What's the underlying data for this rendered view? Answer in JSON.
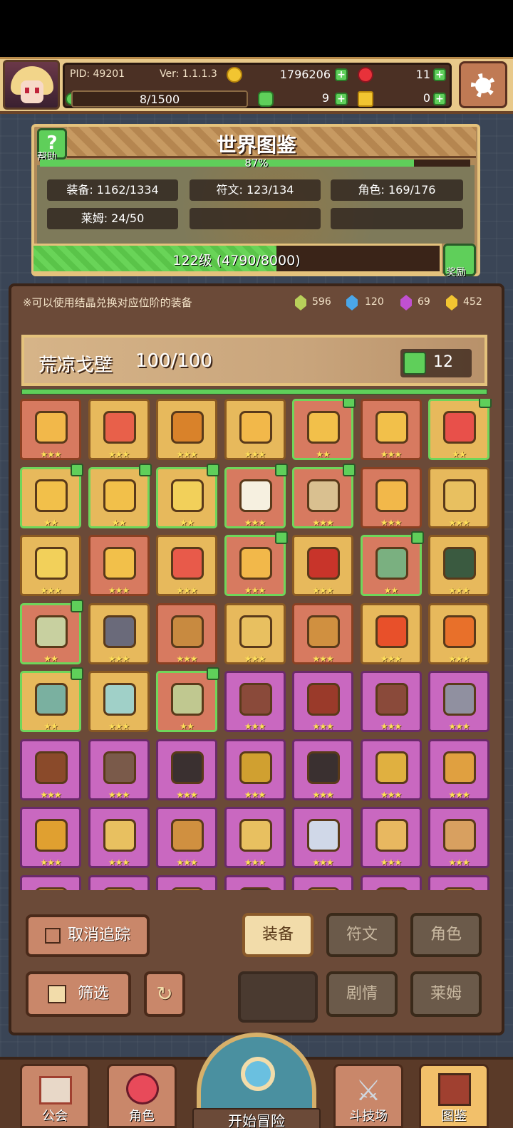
{
  "topbar": {
    "pid": "PID: 49201",
    "version": "Ver: 1.1.1.3",
    "gold": "1796206",
    "red_gems": "11",
    "xp": "8/1500",
    "clover": "9",
    "keys": "0"
  },
  "encyclopedia": {
    "title": "世界图鉴",
    "help_label": "帮助",
    "percent": "87%",
    "percent_value": 87,
    "stats": [
      {
        "label": "装备: 1162/1334"
      },
      {
        "label": "符文: 123/134"
      },
      {
        "label": "角色: 169/176"
      },
      {
        "label": "莱姆: 24/50"
      }
    ],
    "level_text": "122级 (4790/8000)",
    "level_fraction": 0.599,
    "reward_label": "奖励"
  },
  "notice": "※可以使用结晶兑换对应位阶的装备",
  "crystals": [
    {
      "color": "#b8d05a",
      "value": "596"
    },
    {
      "color": "#4aa6e8",
      "value": "120"
    },
    {
      "color": "#c050d0",
      "value": "69"
    },
    {
      "color": "#f2c531",
      "value": "452"
    }
  ],
  "region": {
    "name": "荒凉戈壁",
    "count": "100/100",
    "likes": "12"
  },
  "items": [
    {
      "kind": "red",
      "stars": 3,
      "tracked": false,
      "color": "#f2b84a"
    },
    {
      "kind": "gold",
      "stars": 3,
      "tracked": false,
      "color": "#e8604a"
    },
    {
      "kind": "gold",
      "stars": 3,
      "tracked": false,
      "color": "#d9822a"
    },
    {
      "kind": "gold",
      "stars": 3,
      "tracked": false,
      "color": "#f2b84a"
    },
    {
      "kind": "red",
      "stars": 2,
      "tracked": true,
      "color": "#f2c04a"
    },
    {
      "kind": "red",
      "stars": 3,
      "tracked": false,
      "color": "#f2c04a"
    },
    {
      "kind": "gold",
      "stars": 2,
      "tracked": true,
      "color": "#e8504a"
    },
    {
      "kind": "gold",
      "stars": 2,
      "tracked": true,
      "color": "#f2c04a"
    },
    {
      "kind": "gold",
      "stars": 2,
      "tracked": true,
      "color": "#f2c04a"
    },
    {
      "kind": "gold",
      "stars": 2,
      "tracked": true,
      "color": "#f2d05a"
    },
    {
      "kind": "red",
      "stars": 3,
      "tracked": true,
      "color": "#f6f0e0"
    },
    {
      "kind": "red",
      "stars": 3,
      "tracked": true,
      "color": "#d9c090"
    },
    {
      "kind": "red",
      "stars": 3,
      "tracked": false,
      "color": "#f2b84a"
    },
    {
      "kind": "gold",
      "stars": 3,
      "tracked": false,
      "color": "#e8c060"
    },
    {
      "kind": "gold",
      "stars": 3,
      "tracked": false,
      "color": "#f2d05a"
    },
    {
      "kind": "red",
      "stars": 3,
      "tracked": false,
      "color": "#f2c04a"
    },
    {
      "kind": "gold",
      "stars": 3,
      "tracked": false,
      "color": "#e85a4a"
    },
    {
      "kind": "red",
      "stars": 3,
      "tracked": true,
      "color": "#f2b84a"
    },
    {
      "kind": "gold",
      "stars": 3,
      "tracked": false,
      "color": "#c8342a"
    },
    {
      "kind": "red",
      "stars": 2,
      "tracked": true,
      "color": "#7ab080"
    },
    {
      "kind": "gold",
      "stars": 3,
      "tracked": false,
      "color": "#3a5a40"
    },
    {
      "kind": "red",
      "stars": 2,
      "tracked": true,
      "color": "#c8d0a0"
    },
    {
      "kind": "gold",
      "stars": 3,
      "tracked": false,
      "color": "#6a6a7a"
    },
    {
      "kind": "red",
      "stars": 3,
      "tracked": false,
      "color": "#c88a40"
    },
    {
      "kind": "gold",
      "stars": 3,
      "tracked": false,
      "color": "#e8c060"
    },
    {
      "kind": "red",
      "stars": 3,
      "tracked": false,
      "color": "#d09040"
    },
    {
      "kind": "gold",
      "stars": 3,
      "tracked": false,
      "color": "#e8502a"
    },
    {
      "kind": "gold",
      "stars": 3,
      "tracked": false,
      "color": "#e8702a"
    },
    {
      "kind": "gold",
      "stars": 2,
      "tracked": true,
      "color": "#7ab0a0"
    },
    {
      "kind": "gold",
      "stars": 3,
      "tracked": false,
      "color": "#a0d0c8"
    },
    {
      "kind": "red",
      "stars": 2,
      "tracked": true,
      "color": "#c0c890"
    },
    {
      "kind": "purple",
      "stars": 3,
      "tracked": false,
      "color": "#8a4a3a"
    },
    {
      "kind": "purple",
      "stars": 3,
      "tracked": false,
      "color": "#9a3a2a"
    },
    {
      "kind": "purple",
      "stars": 3,
      "tracked": false,
      "color": "#8a4a3a"
    },
    {
      "kind": "purple",
      "stars": 3,
      "tracked": false,
      "color": "#9090a0"
    },
    {
      "kind": "purple",
      "stars": 3,
      "tracked": false,
      "color": "#8a4a2a"
    },
    {
      "kind": "purple",
      "stars": 3,
      "tracked": false,
      "color": "#7a5a4a"
    },
    {
      "kind": "purple",
      "stars": 3,
      "tracked": false,
      "color": "#3a3030"
    },
    {
      "kind": "purple",
      "stars": 3,
      "tracked": false,
      "color": "#d0a030"
    },
    {
      "kind": "purple",
      "stars": 3,
      "tracked": false,
      "color": "#3a3030"
    },
    {
      "kind": "purple",
      "stars": 3,
      "tracked": false,
      "color": "#e0b040"
    },
    {
      "kind": "purple",
      "stars": 3,
      "tracked": false,
      "color": "#e0a040"
    },
    {
      "kind": "purple",
      "stars": 3,
      "tracked": false,
      "color": "#e0a030"
    },
    {
      "kind": "purple",
      "stars": 3,
      "tracked": false,
      "color": "#e8c060"
    },
    {
      "kind": "purple",
      "stars": 3,
      "tracked": false,
      "color": "#d09040"
    },
    {
      "kind": "purple",
      "stars": 3,
      "tracked": false,
      "color": "#e8c060"
    },
    {
      "kind": "purple",
      "stars": 3,
      "tracked": false,
      "color": "#d0d8e8"
    },
    {
      "kind": "purple",
      "stars": 3,
      "tracked": false,
      "color": "#e8b860"
    },
    {
      "kind": "purple",
      "stars": 3,
      "tracked": false,
      "color": "#d8a060"
    },
    {
      "kind": "purple",
      "stars": 3,
      "tracked": false,
      "color": "#e0a040"
    },
    {
      "kind": "purple",
      "stars": 3,
      "tracked": false,
      "color": "#e0a040"
    },
    {
      "kind": "purple",
      "stars": 3,
      "tracked": false,
      "color": "#e0a040"
    },
    {
      "kind": "purple",
      "stars": 3,
      "tracked": false,
      "color": "#3a3030"
    },
    {
      "kind": "purple",
      "stars": 3,
      "tracked": false,
      "color": "#e0a040"
    },
    {
      "kind": "purple",
      "stars": 3,
      "tracked": false,
      "color": "#8a4a2a"
    },
    {
      "kind": "purple",
      "stars": 3,
      "tracked": false,
      "color": "#e0a040"
    }
  ],
  "controls": {
    "untrack": "取消追踪",
    "filter": "筛选",
    "tab_equipment": "装备",
    "tab_runes": "符文",
    "tab_characters": "角色",
    "tab_story": "剧情",
    "tab_slime": "莱姆"
  },
  "nav": {
    "guild": "公会",
    "character": "角色",
    "adventure": "开始冒险",
    "arena": "斗技场",
    "encyclopedia": "图鉴"
  }
}
